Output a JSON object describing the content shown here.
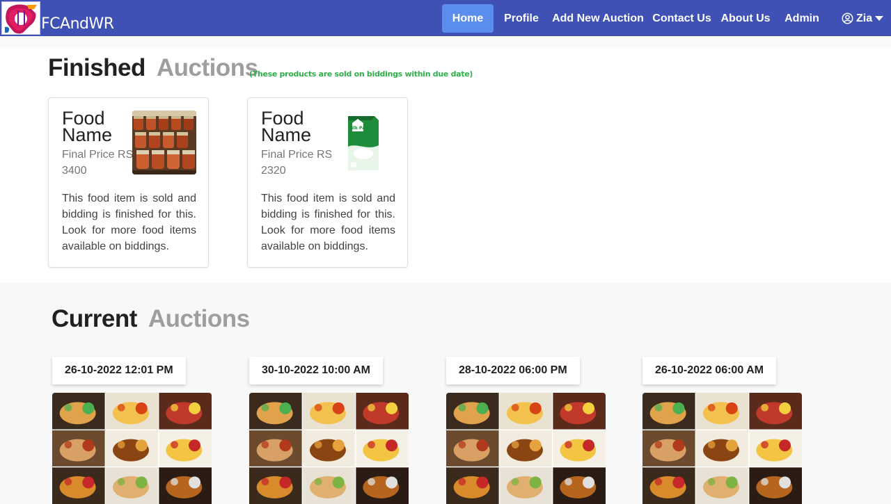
{
  "brand": {
    "name": "FCAndWR"
  },
  "nav": {
    "items": [
      {
        "label": "Home",
        "active": true
      },
      {
        "label": "Profile",
        "active": false
      },
      {
        "label": "Add New Auction",
        "active": false
      },
      {
        "label": "Contact Us",
        "active": false
      },
      {
        "label": "About Us",
        "active": false
      },
      {
        "label": "Admin",
        "active": false
      }
    ],
    "user": {
      "name": "Zia",
      "icon": "user-circle-icon",
      "caret": "caret-down-icon"
    }
  },
  "finished": {
    "title_word1": "Finished",
    "title_word2": "Auctions",
    "note": "(These products are sold on biddings within due date)",
    "cards": [
      {
        "title": "Food Name",
        "price": "Final Price RS 3400",
        "image": "jars-of-sauce-photo",
        "description": "This food item is sold and bidding is finished for this. Look for more food items available on biddings."
      },
      {
        "title": "Food Name",
        "price": "Final Price RS 2320",
        "image": "milk-pak-carton-photo",
        "image_text": "Milk Pak",
        "description": "This food item is sold and bidding is finished for this. Look for more food items available on biddings."
      }
    ]
  },
  "current": {
    "title_word1": "Current",
    "title_word2": "Auctions",
    "auctions": [
      {
        "date": "26-10-2022 12:01 PM",
        "image": "fast-food-collage-photo"
      },
      {
        "date": "30-10-2022 10:00 AM",
        "image": "fast-food-collage-photo"
      },
      {
        "date": "28-10-2022 06:00 PM",
        "image": "fast-food-collage-photo"
      },
      {
        "date": "26-10-2022 06:00 AM",
        "image": "fast-food-collage-photo"
      }
    ]
  },
  "colors": {
    "navbar": "#3f51b5",
    "nav_active": "#5b8def",
    "note_green": "#2fae4a",
    "muted_title": "#9e9e9e"
  }
}
